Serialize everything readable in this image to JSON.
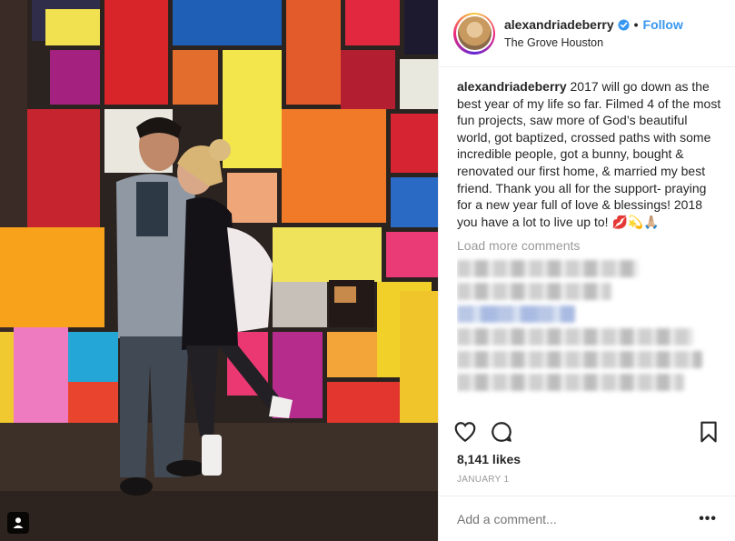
{
  "post": {
    "username": "alexandriadeberry",
    "verified_icon": "verified-badge-icon",
    "dot": "•",
    "follow_label": "Follow",
    "location": "The Grove Houston",
    "caption_user": "alexandriadeberry",
    "caption_text": " 2017 will go down as the best year of my life so far. Filmed 4 of the most fun projects, saw more of God’s beautiful world, got baptized, crossed paths with some incredible people, got a bunny, bought & renovated our first home, & married my best friend. Thank you all for the support- praying for a new year full of love & blessings! 2018 you have a lot to live up to! 💋💫🙏🏼",
    "load_more_label": "Load more comments",
    "likes": "8,141 likes",
    "date": "JANUARY 1",
    "comment_placeholder": "Add a comment...",
    "more_label": "•••"
  },
  "icons": {
    "like": "heart-icon",
    "comment": "comment-icon",
    "save": "bookmark-icon",
    "tag": "person-tag-icon"
  },
  "colors": {
    "accent": "#3897f0",
    "muted": "#999999",
    "text": "#262626"
  }
}
